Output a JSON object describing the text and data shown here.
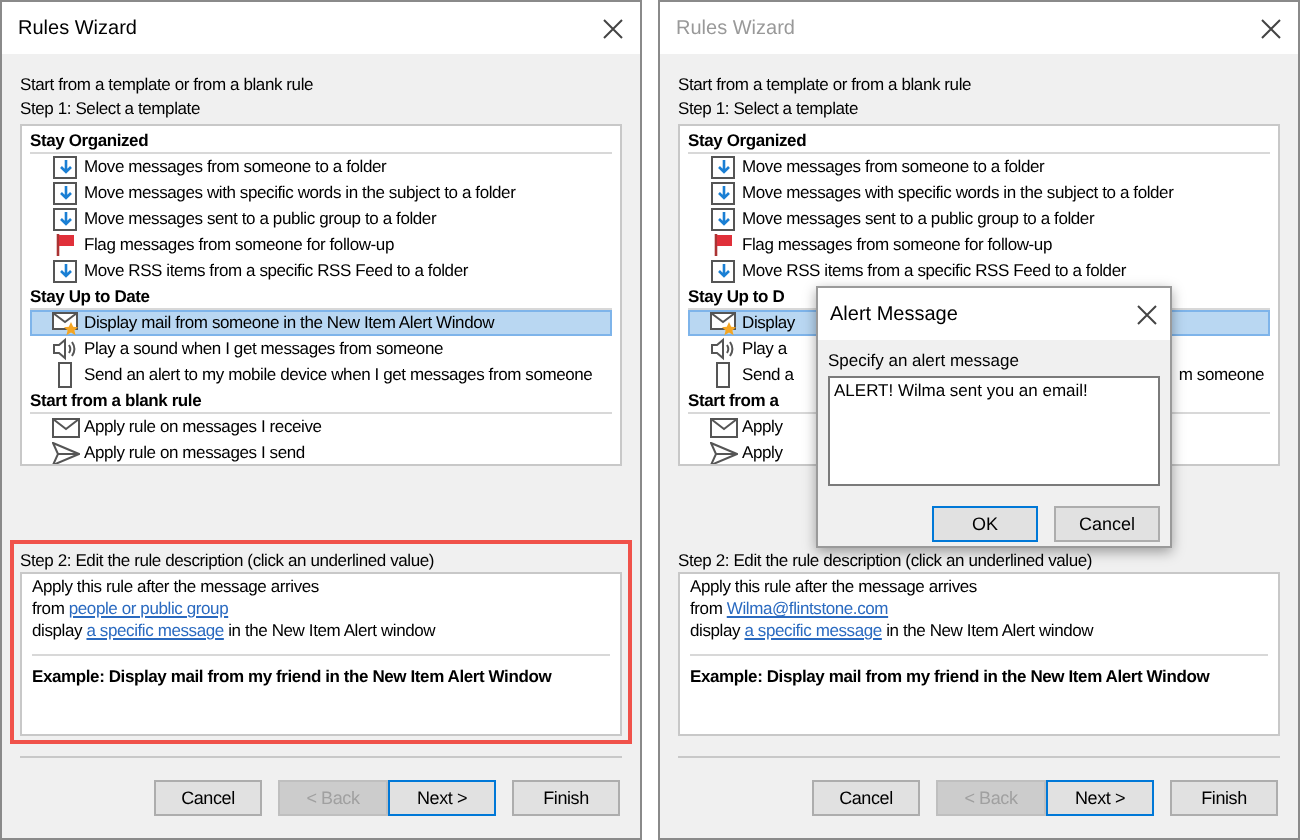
{
  "dialogs": [
    {
      "title": "Rules Wizard",
      "active": true,
      "intro": "Start from a template or from a blank rule",
      "step1": "Step 1: Select a template",
      "groups": [
        {
          "header": "Stay Organized",
          "items": [
            {
              "kind": "move",
              "text": "Move messages from someone to a folder",
              "selected": false
            },
            {
              "kind": "move",
              "text": "Move messages with specific words in the subject to a folder",
              "selected": false
            },
            {
              "kind": "move",
              "text": "Move messages sent to a public group to a folder",
              "selected": false
            },
            {
              "kind": "flag",
              "text": "Flag messages from someone for follow-up",
              "selected": false
            },
            {
              "kind": "move",
              "text": "Move RSS items from a specific RSS Feed to a folder",
              "selected": false
            }
          ]
        },
        {
          "header": "Stay Up to Date",
          "items": [
            {
              "kind": "alert",
              "text": "Display mail from someone in the New Item Alert Window",
              "selected": true
            },
            {
              "kind": "sound",
              "text": "Play a sound when I get messages from someone",
              "selected": false
            },
            {
              "kind": "mobile",
              "text": "Send an alert to my mobile device when I get messages from someone",
              "selected": false
            }
          ]
        },
        {
          "header": "Start from a blank rule",
          "items": [
            {
              "kind": "mail",
              "text": "Apply rule on messages I receive",
              "selected": false
            },
            {
              "kind": "send",
              "text": "Apply rule on messages I send",
              "selected": false
            }
          ]
        }
      ],
      "step2": {
        "label": "Step 2: Edit the rule description (click an underlined value)",
        "highlighted": true,
        "lines": [
          [
            {
              "text": "Apply this rule after the message arrives",
              "link": false
            }
          ],
          [
            {
              "text": "from ",
              "link": false
            },
            {
              "text": "people or public group",
              "link": true
            }
          ],
          [
            {
              "text": "display ",
              "link": false
            },
            {
              "text": "a specific message",
              "link": true
            },
            {
              "text": " in the New Item Alert window",
              "link": false
            }
          ]
        ],
        "example": "Example: Display mail from my friend in the New Item Alert Window"
      },
      "buttons": [
        {
          "label": "Cancel",
          "disabled": false,
          "default": false
        },
        {
          "label": "< Back",
          "disabled": true,
          "default": false
        },
        {
          "label": "Next >",
          "disabled": false,
          "default": true
        },
        {
          "label": "Finish",
          "disabled": false,
          "default": false
        }
      ]
    },
    {
      "title": "Rules Wizard",
      "active": false,
      "intro": "Start from a template or from a blank rule",
      "step1": "Step 1: Select a template",
      "groups": [
        {
          "header": "Stay Organized",
          "items": [
            {
              "kind": "move",
              "text": "Move messages from someone to a folder",
              "selected": false
            },
            {
              "kind": "move",
              "text": "Move messages with specific words in the subject to a folder",
              "selected": false
            },
            {
              "kind": "move",
              "text": "Move messages sent to a public group to a folder",
              "selected": false
            },
            {
              "kind": "flag",
              "text": "Flag messages from someone for follow-up",
              "selected": false
            },
            {
              "kind": "move",
              "text": "Move RSS items from a specific RSS Feed to a folder",
              "selected": false
            }
          ]
        },
        {
          "header": "Stay Up to D",
          "items": [
            {
              "kind": "alert",
              "text": "Display",
              "selected": true
            },
            {
              "kind": "sound",
              "text": "Play a",
              "selected": false
            },
            {
              "kind": "mobile",
              "text": "Send a",
              "tail": "m someone",
              "selected": false
            }
          ]
        },
        {
          "header": "Start from a",
          "items": [
            {
              "kind": "mail",
              "text": "Apply",
              "selected": false
            },
            {
              "kind": "send",
              "text": "Apply",
              "selected": false
            }
          ]
        }
      ],
      "step2": {
        "label": "Step 2: Edit the rule description (click an underlined value)",
        "highlighted": false,
        "lines": [
          [
            {
              "text": "Apply this rule after the message arrives",
              "link": false
            }
          ],
          [
            {
              "text": "from ",
              "link": false
            },
            {
              "text": "Wilma@flintstone.com",
              "link": true
            }
          ],
          [
            {
              "text": "display ",
              "link": false
            },
            {
              "text": "a specific message",
              "link": true
            },
            {
              "text": " in the New Item Alert window",
              "link": false
            }
          ]
        ],
        "example": "Example: Display mail from my friend in the New Item Alert Window"
      },
      "buttons": [
        {
          "label": "Cancel",
          "disabled": false,
          "default": false
        },
        {
          "label": "< Back",
          "disabled": true,
          "default": false
        },
        {
          "label": "Next >",
          "disabled": false,
          "default": true
        },
        {
          "label": "Finish",
          "disabled": false,
          "default": false
        }
      ],
      "alert": {
        "title": "Alert Message",
        "prompt": "Specify an alert message",
        "value": "ALERT! Wilma sent you an email!",
        "buttons": [
          {
            "label": "OK",
            "disabled": false,
            "default": true
          },
          {
            "label": "Cancel",
            "disabled": false,
            "default": false
          }
        ]
      }
    }
  ]
}
